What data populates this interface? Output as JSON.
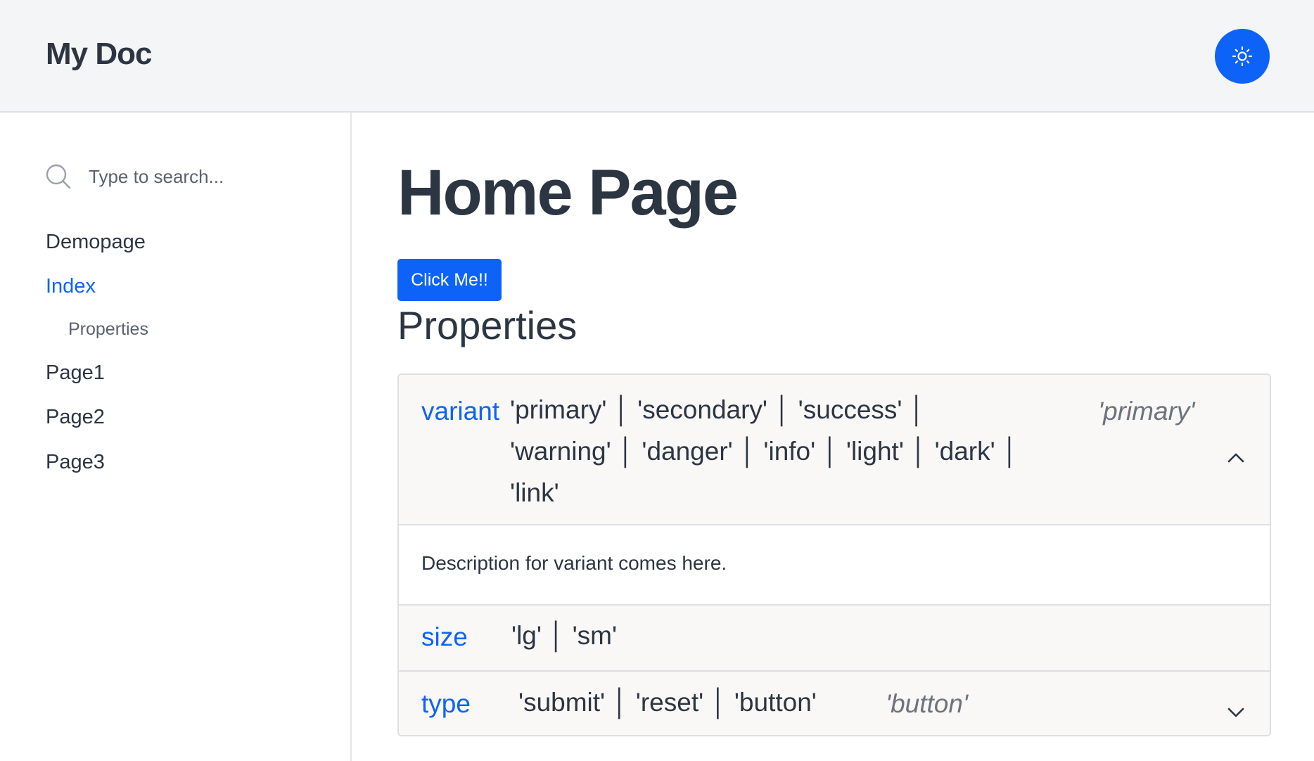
{
  "header": {
    "brand": "My Doc",
    "theme_toggle_icon": "sun-icon",
    "accent_color": "#0d63f8"
  },
  "sidebar": {
    "search": {
      "placeholder": "Type to search...",
      "value": "",
      "icon": "search-icon"
    },
    "items": [
      {
        "label": "Demopage",
        "active": false
      },
      {
        "label": "Index",
        "active": true
      },
      {
        "label": "Page1",
        "active": false
      },
      {
        "label": "Page2",
        "active": false
      },
      {
        "label": "Page3",
        "active": false
      }
    ],
    "subitems": [
      {
        "label": "Properties",
        "parent": "Index"
      }
    ]
  },
  "main": {
    "title": "Home Page",
    "button_label": "Click Me!!",
    "section_title": "Properties",
    "properties": [
      {
        "name": "variant",
        "types": [
          "'primary'",
          "'secondary'",
          "'success'",
          "'warning'",
          "'danger'",
          "'info'",
          "'light'",
          "'dark'",
          "'link'"
        ],
        "type_lines": [
          "'primary' │ 'secondary' │ 'success' │",
          "'warning' │ 'danger' │ 'info' │ 'light' │ 'dark' │",
          "'link'"
        ],
        "default": "'primary'",
        "expanded": true,
        "description": "Description for variant comes here."
      },
      {
        "name": "size",
        "types": [
          "'lg'",
          "'sm'"
        ],
        "type_lines": [
          "'lg' │ 'sm'"
        ],
        "default": "",
        "expanded": false
      },
      {
        "name": "type",
        "types": [
          "'submit'",
          "'reset'",
          "'button'"
        ],
        "type_lines": [
          "'submit' │ 'reset' │ 'button'"
        ],
        "default": "'button'",
        "expanded": false
      }
    ]
  }
}
